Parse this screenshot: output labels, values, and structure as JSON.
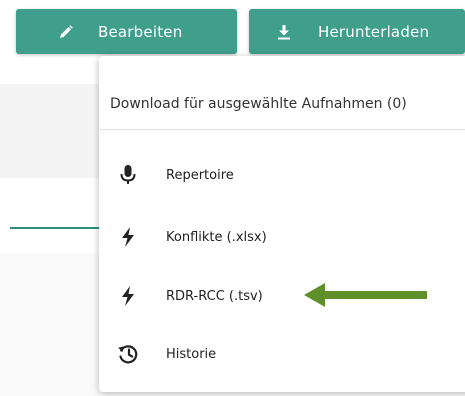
{
  "toolbar": {
    "edit_label": "Bearbeiten",
    "download_label": "Herunterladen"
  },
  "colors": {
    "button": "#3f9e8c",
    "accent_line": "#2a8f7e",
    "annotation_arrow": "#5e8f2a"
  },
  "download_menu": {
    "header": "Download für ausgewählte Aufnahmen (0)",
    "items": [
      {
        "label": "Repertoire",
        "icon": "microphone-icon"
      },
      {
        "label": "Konflikte (.xlsx)",
        "icon": "lightning-icon"
      },
      {
        "label": "RDR-RCC (.tsv)",
        "icon": "lightning-icon"
      },
      {
        "label": "Historie",
        "icon": "history-icon"
      }
    ]
  }
}
